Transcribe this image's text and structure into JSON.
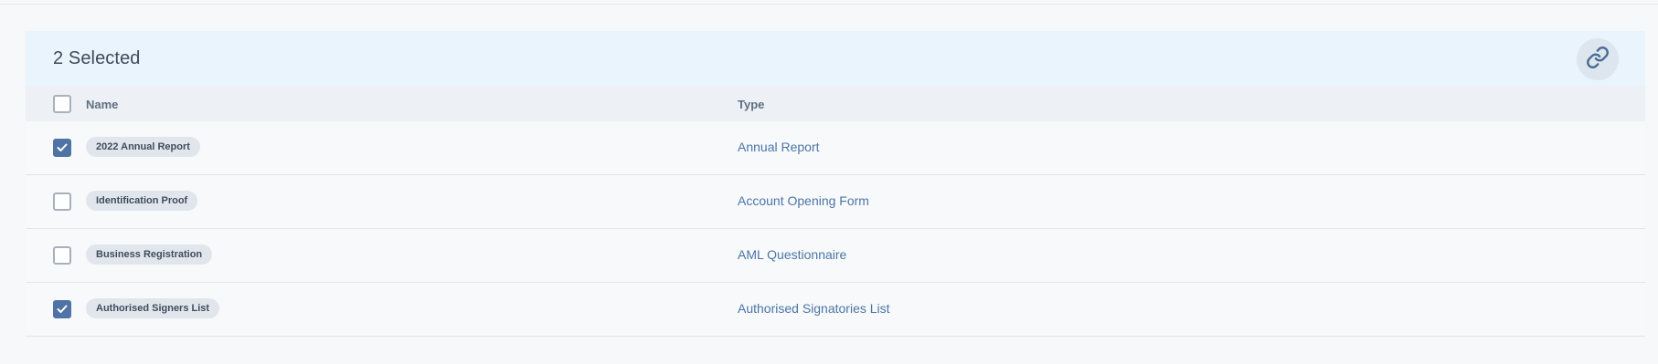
{
  "selection": {
    "count_label": "2 Selected"
  },
  "table": {
    "columns": {
      "name": "Name",
      "type": "Type"
    },
    "rows": [
      {
        "name": "2022 Annual Report",
        "type": "Annual Report",
        "checked": true
      },
      {
        "name": "Identification Proof",
        "type": "Account Opening Form",
        "checked": false
      },
      {
        "name": "Business Registration",
        "type": "AML Questionnaire",
        "checked": false
      },
      {
        "name": "Authorised Signers List",
        "type": "Authorised Signatories List",
        "checked": true
      }
    ]
  },
  "icons": {
    "link_button": "link-icon",
    "checkbox_checked": "check-icon"
  },
  "colors": {
    "accent": "#4f73a4",
    "type_link": "#4d75a6",
    "selection_bar_bg": "#eaf4fd",
    "header_bg": "#edf1f5"
  }
}
